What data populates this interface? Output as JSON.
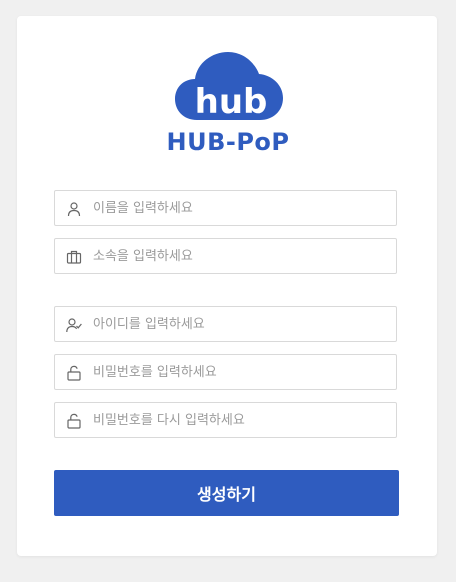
{
  "brand": {
    "name": "HUB-PoP",
    "logo_mark": "hub",
    "color": "#2f5cbf"
  },
  "form": {
    "fields": [
      {
        "icon": "user-icon",
        "placeholder": "이름을 입력하세요",
        "value": ""
      },
      {
        "icon": "briefcase-icon",
        "placeholder": "소속을 입력하세요",
        "value": ""
      },
      {
        "icon": "user-check-icon",
        "placeholder": "아이디를 입력하세요",
        "value": ""
      },
      {
        "icon": "unlock-icon",
        "placeholder": "비밀번호를 입력하세요",
        "value": ""
      },
      {
        "icon": "unlock-icon",
        "placeholder": "비밀번호를 다시 입력하세요",
        "value": ""
      }
    ],
    "submit_label": "생성하기"
  },
  "colors": {
    "accent": "#2f5cbf",
    "background": "#f0f0f0",
    "card": "#ffffff",
    "border": "#d9d9d9",
    "placeholder": "#9a9a9a"
  }
}
